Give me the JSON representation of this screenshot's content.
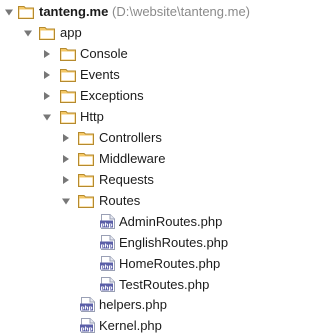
{
  "project_tree": {
    "root": {
      "label": "tanteng.me",
      "path": "(D:\\website\\tanteng.me)",
      "expanded": true
    },
    "app": {
      "label": "app",
      "expanded": true,
      "children": {
        "console": {
          "label": "Console",
          "expanded": false
        },
        "events": {
          "label": "Events",
          "expanded": false
        },
        "exceptions": {
          "label": "Exceptions",
          "expanded": false
        },
        "http": {
          "label": "Http",
          "expanded": true,
          "children": {
            "controllers": {
              "label": "Controllers",
              "expanded": false
            },
            "middleware": {
              "label": "Middleware",
              "expanded": false
            },
            "requests": {
              "label": "Requests",
              "expanded": false
            },
            "routes": {
              "label": "Routes",
              "expanded": true,
              "files": [
                {
                  "label": "AdminRoutes.php",
                  "icon": "php-file-icon"
                },
                {
                  "label": "EnglishRoutes.php",
                  "icon": "php-file-icon"
                },
                {
                  "label": "HomeRoutes.php",
                  "icon": "php-file-icon"
                },
                {
                  "label": "TestRoutes.php",
                  "icon": "php-file-icon"
                }
              ]
            }
          }
        }
      },
      "files": [
        {
          "label": "helpers.php",
          "icon": "php-file-icon"
        },
        {
          "label": "Kernel.php",
          "icon": "php-file-icon"
        }
      ]
    },
    "icon_colors": {
      "folder_fill": "#f4c766",
      "folder_stroke": "#b58a2e",
      "arrow": "#777777",
      "php_badge": "#5b5fa8"
    }
  }
}
